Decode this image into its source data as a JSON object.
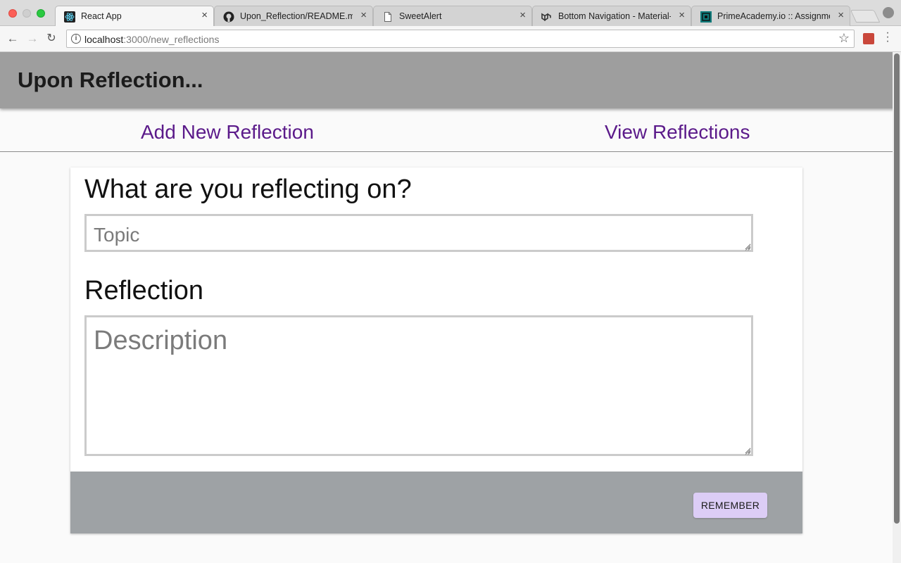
{
  "browser": {
    "tabs": [
      {
        "title": "React App",
        "icon": "react-icon",
        "active": true
      },
      {
        "title": "Upon_Reflection/README.md",
        "icon": "github-icon",
        "active": false
      },
      {
        "title": "SweetAlert",
        "icon": "document-icon",
        "active": false
      },
      {
        "title": "Bottom Navigation - Material-UI",
        "icon": "material-ui-icon",
        "active": false
      },
      {
        "title": "PrimeAcademy.io :: Assignments",
        "icon": "prime-academy-icon",
        "active": false
      }
    ],
    "address": {
      "host": "localhost",
      "path": ":3000/new_reflections"
    }
  },
  "app": {
    "title": "Upon Reflection...",
    "appbar_color": "#9e9e9e",
    "nav": {
      "add_label": "Add New Reflection",
      "view_label": "View Reflections",
      "link_color": "#5b1a8a"
    }
  },
  "form": {
    "topic_heading": "What are you reflecting on?",
    "topic_placeholder": "Topic",
    "topic_value": "",
    "reflection_heading": "Reflection",
    "description_placeholder": "Description",
    "description_value": "",
    "submit_label": "REMEMBER",
    "submit_color": "#dccdf6",
    "footer_color": "#9ea2a5"
  }
}
